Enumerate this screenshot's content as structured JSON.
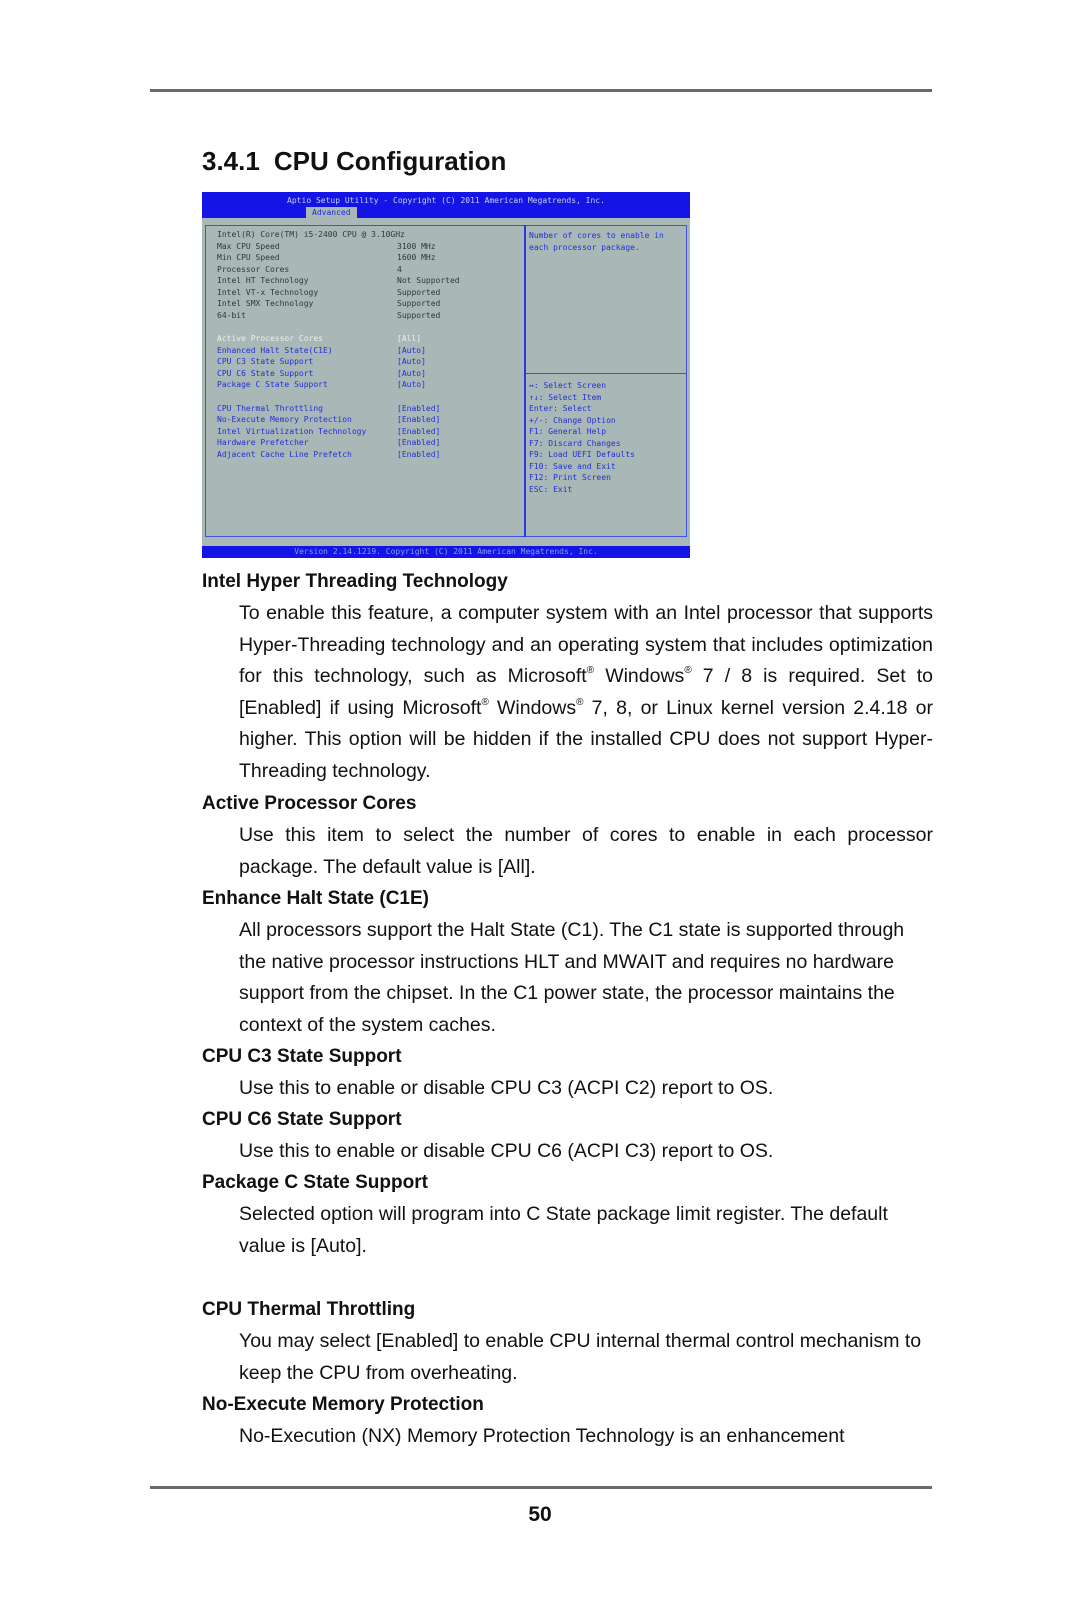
{
  "page": {
    "section_number": "3.4.1",
    "section_title": "CPU Configuration",
    "page_number": "50"
  },
  "bios": {
    "header_title": "Aptio Setup Utility - Copyright (C) 2011 American Megatrends, Inc.",
    "active_tab": "Advanced",
    "footer": "Version 2.14.1219. Copyright (C) 2011 American Megatrends, Inc.",
    "cpu_name": "Intel(R) Core(TM) i5-2400 CPU @ 3.10GHz",
    "info_rows": [
      {
        "label": "Max CPU Speed",
        "value": "3100 MHz"
      },
      {
        "label": "Min CPU Speed",
        "value": "1600 MHz"
      },
      {
        "label": "Processor Cores",
        "value": "4"
      },
      {
        "label": "Intel HT Technology",
        "value": "Not Supported"
      },
      {
        "label": "Intel VT-x Technology",
        "value": "Supported"
      },
      {
        "label": "Intel SMX Technology",
        "value": "Supported"
      },
      {
        "label": "64-bit",
        "value": "Supported"
      }
    ],
    "option_group1": [
      {
        "label": "Active Processor Cores",
        "value": "[All]",
        "selected": true
      },
      {
        "label": "Enhanced Halt State(C1E)",
        "value": "[Auto]"
      },
      {
        "label": "CPU C3 State Support",
        "value": "[Auto]"
      },
      {
        "label": "CPU C6 State Support",
        "value": "[Auto]"
      },
      {
        "label": "Package C State Support",
        "value": "[Auto]"
      }
    ],
    "option_group2": [
      {
        "label": "CPU Thermal Throttling",
        "value": "[Enabled]"
      },
      {
        "label": "No-Execute Memory Protection",
        "value": "[Enabled]"
      },
      {
        "label": "Intel Virtualization Technology",
        "value": "[Enabled]"
      },
      {
        "label": "Hardware Prefetcher",
        "value": "[Enabled]"
      },
      {
        "label": "Adjacent Cache Line Prefetch",
        "value": "[Enabled]"
      }
    ],
    "help_lines": [
      "Number of cores to enable in",
      "each processor package."
    ],
    "key_lines": [
      "↔: Select Screen",
      "↑↓: Select Item",
      "Enter: Select",
      "+/-: Change Option",
      "F1: General Help",
      "F7: Discard Changes",
      "F9: Load UEFI Defaults",
      "F10: Save and Exit",
      "F12: Print Screen",
      "ESC: Exit"
    ]
  },
  "sections": [
    {
      "heading": "Intel Hyper Threading Technology"
    },
    {
      "heading": "Active Processor Cores",
      "body": "Use this item to select the number of cores to enable in each processor package. The default value is [All]."
    },
    {
      "heading": "Enhance Halt State (C1E)",
      "body": "All processors support the Halt State (C1). The C1 state is supported through the native processor instructions HLT and MWAIT and requires no hardware support from the chipset. In the C1 power state, the processor maintains the context of the system caches."
    },
    {
      "heading": "CPU C3 State Support",
      "body": "Use this to enable or disable CPU C3 (ACPI C2) report to OS."
    },
    {
      "heading": "CPU C6 State Support",
      "body": "Use this to enable or disable CPU C6 (ACPI C3) report to OS."
    },
    {
      "heading": "Package C State Support",
      "body": "Selected option will program into C State package limit register. The default value is [Auto]."
    },
    {
      "heading": "CPU Thermal Throttling",
      "body": "You may select [Enabled] to enable CPU internal thermal control mechanism to keep the CPU from overheating."
    },
    {
      "heading": "No-Execute Memory Protection",
      "body": "No-Execution (NX) Memory Protection Technology is an enhancement"
    }
  ],
  "ht_body": {
    "part1": "To enable this feature, a computer system with an Intel processor that supports Hyper-Threading technology and an operating system that includes optimization for this technology, such as Microsoft",
    "reg": "®",
    "part2": " Windows",
    "part3": " 7 / 8 is required. Set to [Enabled] if using Microsoft",
    "part4": " Windows",
    "part5": " 7, 8, or Linux kernel version 2.4.18 or higher. This option will be hidden if the installed CPU does not support Hyper-Threading technology."
  }
}
